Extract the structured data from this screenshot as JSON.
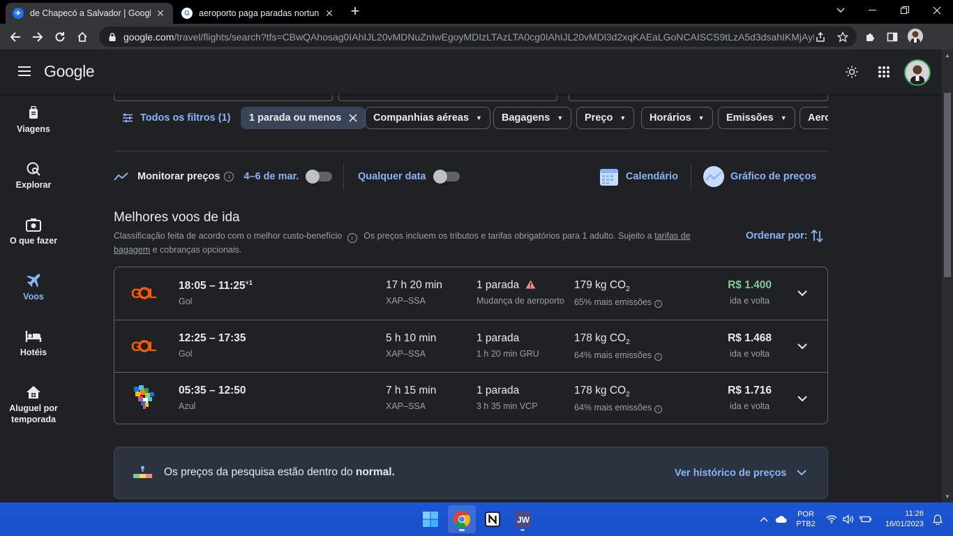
{
  "browser": {
    "tabs": [
      {
        "title": "de Chapecó a Salvador | Google Voos",
        "favicon": "google-flights-icon",
        "active": true
      },
      {
        "title": "aeroporto paga paradas nortunas - Pesquisa Google",
        "favicon": "google-g-icon",
        "active": false
      }
    ],
    "url_domain": "google.com",
    "url_path": "/travel/flights/search?tfs=CBwQAhosag0IAhIJL20vMDNuZnIwEgoyMDIzLTAzLTA0cg0IAhIJL20vMDl3d2xqKAEaLGoNCAISCS9tLzA5d3dsahIKMjAyM..."
  },
  "header": {
    "logo": "Google"
  },
  "sidebar": {
    "items": [
      {
        "label": "Viagens",
        "icon": "luggage-icon"
      },
      {
        "label": "Explorar",
        "icon": "explore-icon"
      },
      {
        "label": "O que fazer",
        "icon": "camera-icon"
      },
      {
        "label": "Voos",
        "icon": "airplane-icon",
        "active": true
      },
      {
        "label": "Hotéis",
        "icon": "bed-icon"
      },
      {
        "label": "Aluguel por temporada",
        "icon": "house-icon"
      }
    ]
  },
  "filters": {
    "all_filters": "Todos os filtros (1)",
    "chips": [
      {
        "label": "1 parada ou menos",
        "selected": true
      },
      {
        "label": "Companhias aéreas"
      },
      {
        "label": "Bagagens"
      },
      {
        "label": "Preço"
      },
      {
        "label": "Horários"
      },
      {
        "label": "Emissões"
      },
      {
        "label": "Aero"
      }
    ]
  },
  "tracking": {
    "monitor_label": "Monitorar preços",
    "date_range": "4–6 de mar.",
    "any_date": "Qualquer data",
    "calendar": "Calendário",
    "price_graph": "Gráfico de preços"
  },
  "results": {
    "title": "Melhores voos de ida",
    "subtitle_a": "Classificação feita de acordo com o melhor custo-benefício",
    "subtitle_b": "Os preços incluem os tributos e tarifas obrigatórios para 1 adulto. Sujeito a",
    "subtitle_link": "tarifas de bagagem",
    "subtitle_c": "e cobranças opcionais.",
    "sort_by": "Ordenar por:",
    "flights": [
      {
        "times": "18:05 – 11:25",
        "plus_day": "+1",
        "airline": "Gol",
        "duration": "17 h 20 min",
        "route": "XAP–SSA",
        "stops": "1 parada",
        "stop_detail": "Mudança de aeroporto",
        "co2": "179 kg CO",
        "emissions": "65% mais emissões",
        "price": "R$ 1.400",
        "price_note": "ida e volta",
        "price_color": "#81c995",
        "warning": true
      },
      {
        "times": "12:25 – 17:35",
        "plus_day": "",
        "airline": "Gol",
        "duration": "5 h 10 min",
        "route": "XAP–SSA",
        "stops": "1 parada",
        "stop_detail": "1 h 20 min GRU",
        "co2": "178 kg CO",
        "emissions": "64% mais emissões",
        "price": "R$ 1.468",
        "price_note": "ida e volta",
        "warning": false
      },
      {
        "times": "05:35 – 12:50",
        "plus_day": "",
        "airline": "Azul",
        "duration": "7 h 15 min",
        "route": "XAP–SSA",
        "stops": "1 parada",
        "stop_detail": "3 h 35 min VCP",
        "co2": "178 kg CO",
        "emissions": "64% mais emissões",
        "price": "R$ 1.716",
        "price_note": "ida e volta",
        "warning": false
      }
    ]
  },
  "insight": {
    "text_a": "Os preços da pesquisa estão dentro do",
    "text_b": "normal.",
    "link": "Ver histórico de preços"
  },
  "taskbar": {
    "apps": [
      "windows-start-icon",
      "chrome-icon",
      "notion-icon",
      "jw-icon"
    ],
    "lang_top": "POR",
    "lang_bottom": "PTB2",
    "time": "11:26",
    "date": "16/01/2023"
  },
  "colors": {
    "accent": "#8ab4f8",
    "price_low": "#81c995",
    "background": "#202124"
  }
}
